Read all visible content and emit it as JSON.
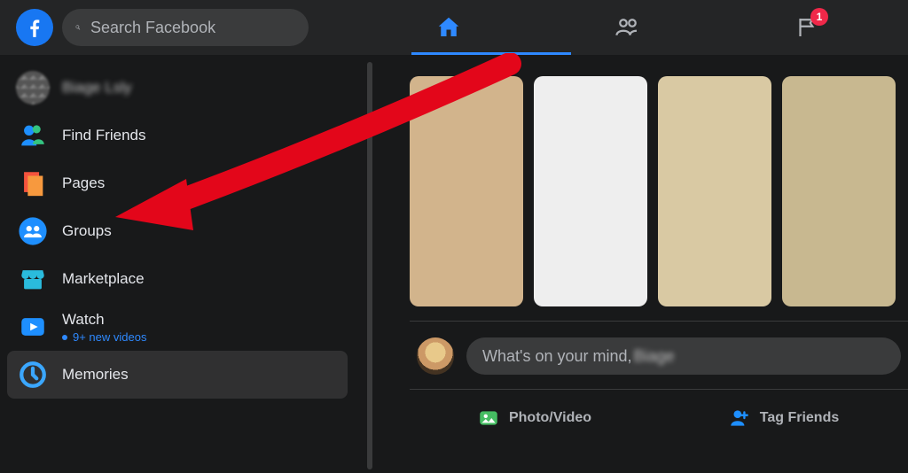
{
  "topbar": {
    "search_placeholder": "Search Facebook",
    "badges": {
      "pages_count": "1"
    }
  },
  "sidebar": {
    "user_name": "Biage Lsly",
    "items": [
      {
        "label": "Find Friends"
      },
      {
        "label": "Pages"
      },
      {
        "label": "Groups"
      },
      {
        "label": "Marketplace"
      },
      {
        "label": "Watch",
        "sub": "9+ new videos"
      },
      {
        "label": "Memories"
      }
    ]
  },
  "composer": {
    "placeholder_prefix": "What's on your mind, ",
    "placeholder_name": "Biage",
    "actions": {
      "photo_video": "Photo/Video",
      "tag_friends": "Tag Friends"
    }
  },
  "colors": {
    "accent": "#2e89ff",
    "danger": "#f02849",
    "surface": "#242526",
    "background": "#18191a"
  },
  "annotation": {
    "target": "sidebar-item-pages"
  }
}
